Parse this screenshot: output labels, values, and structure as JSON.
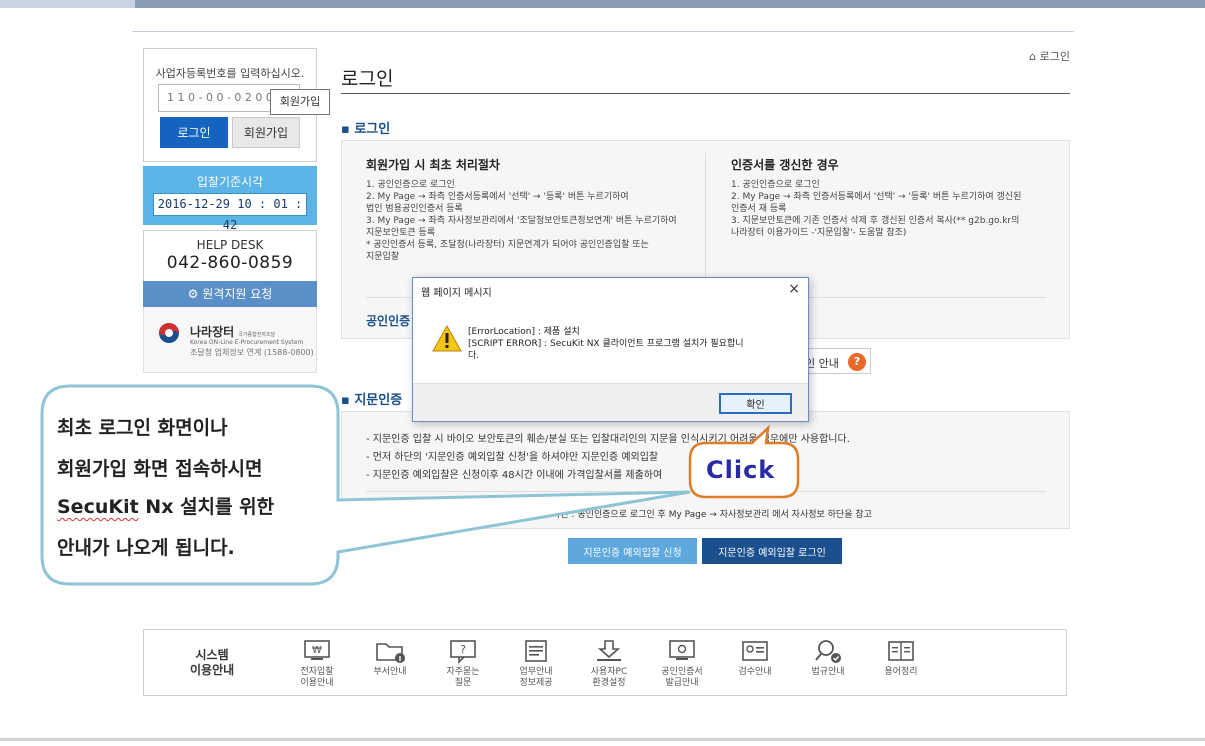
{
  "sidebar": {
    "login": {
      "title": "사업자등록번호를 입력하십시오.",
      "input_value": "1 1 0 - 0 0 - 0 2 0 0 1",
      "tooltip": "회원가입",
      "login_button": "로그인",
      "join_button": "회원가입"
    },
    "bid_time": {
      "title": "입찰기준시각",
      "value": "2016-12-29 10 : 01 : 42"
    },
    "help_desk": {
      "title": "HELP DESK",
      "phone": "042-860-0859",
      "remote_button": "원격지원 요청"
    },
    "narajang": {
      "name": "나라장터",
      "name_sub": "국가종합전자조달",
      "english": "Korea ON-Line E-Procurement System",
      "contact": "조달청 업체정보 연계 (1588-0800)"
    }
  },
  "breadcrumb": "로그인",
  "page_title": "로그인",
  "login_section": {
    "title": "로그인",
    "left_heading": "회원가입 시 최초 처리절차",
    "left_lines": [
      "1. 공인인증으로 로그인",
      "2. My Page → 좌측 인증서등록에서 '선택' → '등록' 버튼 누르기하여",
      "    법인 범용공인인증서 등록",
      "3. My Page → 좌측 자사정보관리에서 '조달청보안토큰정보연계' 버튼 누르기하여",
      "    지문보안토큰 등록",
      "* 공인인증서 등록, 조달청(나라장터) 지문연계가 되어야 공인인증입찰 또는",
      "    지문입찰"
    ],
    "right_heading": "인증서를 갱신한 경우",
    "right_lines": [
      "1. 공인인증으로 로그인",
      "2. My Page → 좌측 인증서등록에서 '선택' → '등록' 버튼 누르기하여 갱신된",
      "    인증서 재 등록",
      "3. 지문보안토큰에 기존 인증서 삭제 후 갱신된 인증서 복사(** g2b.go.kr의",
      "    나라장터 이용가이드 -'지문입찰'- 도움말 참조)"
    ],
    "cert_login_link": "공인인증",
    "cert_guide": "인 안내",
    "help_mark": "?"
  },
  "fingerprint_section": {
    "title": "지문인증",
    "lines": [
      "- 지문인증 입찰 시 바이오 보안토큰의 훼손/분실 또는 입찰대리인의 지문을 인식시키기 어려울 경우에만 사용합니다.",
      "- 먼저 하단의 '지문인증 예외입찰 신청'을 하셔야만 지문인증 예외입찰",
      "- 지문인증 예외입찰은 신청이후 48시간 이내에 가격입찰서를 제출하여"
    ],
    "note": "확인 : 공인인증으로 로그인 후 My Page → 자사정보관리 에서 자사정보 하단을 참고",
    "apply_button": "지문인증 예외입찰 신청",
    "fp_login_button": "지문인증 예외입찰 로그인"
  },
  "footer": {
    "title_line1": "시스템",
    "title_line2": "이용안내",
    "items": [
      {
        "icon": "won-monitor-icon",
        "line1": "전자입찰",
        "line2": "이용안내"
      },
      {
        "icon": "folder-info-icon",
        "line1": "부서안내",
        "line2": ""
      },
      {
        "icon": "question-bubble-icon",
        "line1": "자주묻는",
        "line2": "질문"
      },
      {
        "icon": "document-list-icon",
        "line1": "업무안내",
        "line2": "정보제공"
      },
      {
        "icon": "download-pc-icon",
        "line1": "사용자PC",
        "line2": "환경설정"
      },
      {
        "icon": "certificate-monitor-icon",
        "line1": "공인인증서",
        "line2": "발급안내"
      },
      {
        "icon": "inspection-card-icon",
        "line1": "검수안내",
        "line2": ""
      },
      {
        "icon": "law-search-icon",
        "line1": "법규안내",
        "line2": ""
      },
      {
        "icon": "glossary-book-icon",
        "line1": "용어정리",
        "line2": ""
      }
    ]
  },
  "dialog": {
    "title": "웹 페이지 메시지",
    "close": "×",
    "line1": "[ErrorLocation] : 제품 설치",
    "line2": "[SCRIPT ERROR] :  SecuKit NX 클라이언트 프로그램 설치가 필요합니",
    "line3": "다.",
    "ok_button": "확인"
  },
  "callout": {
    "line1": "최초 로그인 화면이나",
    "line2": "회원가입 화면 접속하시면",
    "line3_underlined": "SecuKit",
    "line3_rest": " Nx 설치를 위한",
    "line4": "안내가 나오게 됩니다."
  },
  "click_label": "Click",
  "colors": {
    "primary_blue": "#1565c0",
    "sky_blue": "#5cb3e6",
    "callout_border": "#8fc3d6",
    "click_border": "#e07b26",
    "click_text": "#2a2aa8"
  }
}
